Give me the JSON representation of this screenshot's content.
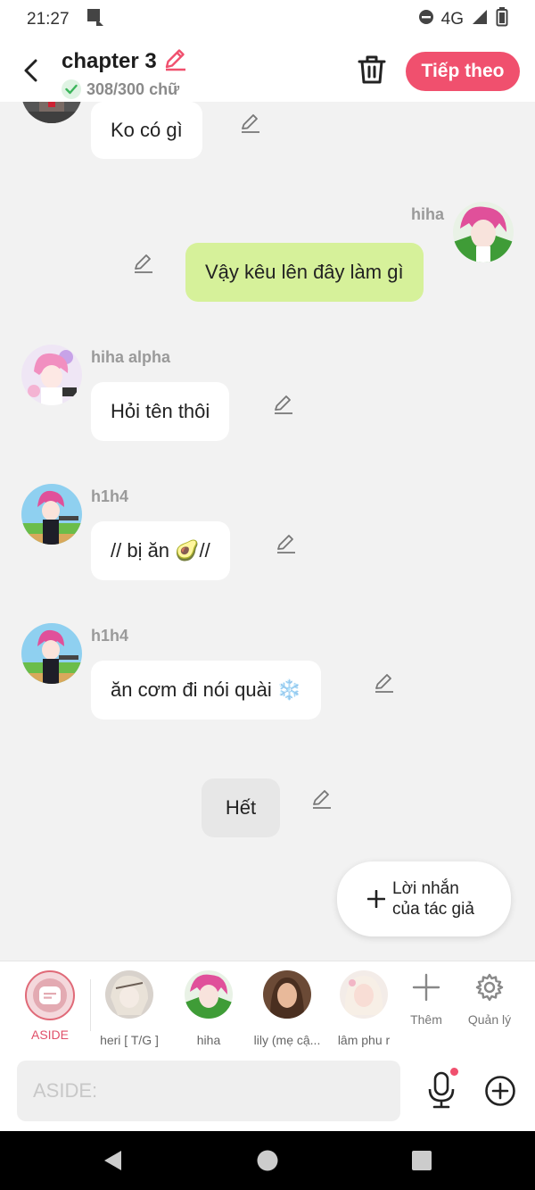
{
  "status_bar": {
    "time": "21:27",
    "network": "4G"
  },
  "header": {
    "title": "chapter 3",
    "word_count": "308/300 chữ",
    "next_label": "Tiếp theo"
  },
  "messages": [
    {
      "sender": "",
      "text": "Ko có gì",
      "side": "left"
    },
    {
      "sender": "hiha",
      "text": "Vậy kêu lên đây làm gì",
      "side": "right"
    },
    {
      "sender": "hiha alpha",
      "text": "Hỏi tên thôi",
      "side": "left"
    },
    {
      "sender": "h1h4",
      "text": "// bị ăn 🥑//",
      "side": "left"
    },
    {
      "sender": "h1h4",
      "text": "ăn cơm đi nói quài ❄️",
      "side": "left"
    },
    {
      "sender": "",
      "text": "Hết",
      "side": "center"
    }
  ],
  "author_note": {
    "label_line1": "Lời nhắn",
    "label_line2": "của tác giả"
  },
  "characters": [
    {
      "label": "ASIDE"
    },
    {
      "label": "heri [ T/G ]"
    },
    {
      "label": "hiha"
    },
    {
      "label": "lily (mẹ cậ..."
    },
    {
      "label": "lâm phu r"
    }
  ],
  "tools": {
    "add_label": "Thêm",
    "manage_label": "Quản lý"
  },
  "composer": {
    "placeholder": "ASIDE:"
  },
  "colors": {
    "accent": "#f0506e",
    "green_bubble": "#d6f19a",
    "background": "#f2f2f2"
  }
}
